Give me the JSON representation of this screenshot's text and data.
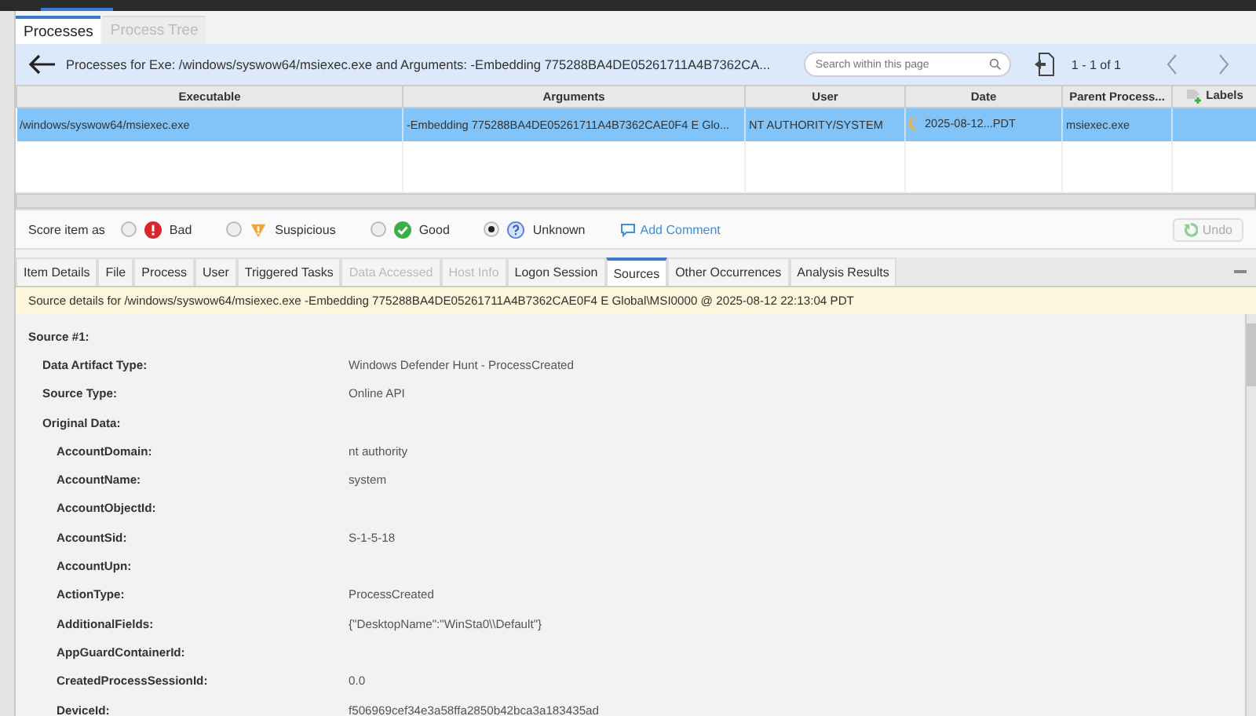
{
  "tabs": [
    {
      "label": "Processes",
      "selected": true
    },
    {
      "label": "Process Tree",
      "selected": false
    }
  ],
  "header": {
    "title": "Processes for Exe: /windows/syswow64/msiexec.exe and Arguments: -Embedding 775288BA4DE05261711A4B7362CA...",
    "search": {
      "placeholder": "Search within this page"
    },
    "range": "1 - 1 of 1"
  },
  "table": {
    "columns": [
      "Executable",
      "Arguments",
      "User",
      "Date",
      "Parent Process...",
      "Labels"
    ],
    "rows": [
      {
        "selected": true,
        "cells": [
          "/windows/syswow64/msiexec.exe",
          "-Embedding 775288BA4DE05261711A4B7362CAE0F4 E Glo...",
          "NT AUTHORITY/SYSTEM",
          "2025-08-12...PDT",
          "msiexec.exe",
          ""
        ]
      }
    ]
  },
  "score": {
    "label": "Score item as",
    "options": [
      {
        "kind": "bad",
        "label": "Bad",
        "selected": false
      },
      {
        "kind": "suspicious",
        "label": "Suspicious",
        "selected": false
      },
      {
        "kind": "good",
        "label": "Good",
        "selected": false
      },
      {
        "kind": "unknown",
        "label": "Unknown",
        "selected": true
      }
    ],
    "comment": "Add Comment",
    "undo": {
      "label": "Undo",
      "disabled": true
    }
  },
  "detail_tabs": [
    {
      "label": "Item Details",
      "selected": false,
      "disabled": false
    },
    {
      "label": "File",
      "selected": false,
      "disabled": false
    },
    {
      "label": "Process",
      "selected": false,
      "disabled": false
    },
    {
      "label": "User",
      "selected": false,
      "disabled": false
    },
    {
      "label": "Triggered Tasks",
      "selected": false,
      "disabled": false
    },
    {
      "label": "Data Accessed",
      "selected": false,
      "disabled": true
    },
    {
      "label": "Host Info",
      "selected": false,
      "disabled": true
    },
    {
      "label": "Logon Session",
      "selected": false,
      "disabled": false
    },
    {
      "label": "Sources",
      "selected": true,
      "disabled": false
    },
    {
      "label": "Other Occurrences",
      "selected": false,
      "disabled": false
    },
    {
      "label": "Analysis Results",
      "selected": false,
      "disabled": false
    }
  ],
  "banner": "Source details for /windows/syswow64/msiexec.exe -Embedding 775288BA4DE05261711A4B7362CAE0F4 E Global\\MSI0000 @ 2025-08-12 22:13:04 PDT",
  "details": [
    {
      "label": "Source #1:",
      "children": [
        {
          "label": "Data Artifact Type:",
          "value": "Windows Defender Hunt - ProcessCreated"
        },
        {
          "label": "Source Type:",
          "value": "Online API"
        },
        {
          "label": "Original Data:",
          "children": [
            {
              "label": "AccountDomain:",
              "value": "nt authority"
            },
            {
              "label": "AccountName:",
              "value": "system"
            },
            {
              "label": "AccountObjectId:"
            },
            {
              "label": "AccountSid:",
              "value": "S-1-5-18"
            },
            {
              "label": "AccountUpn:"
            },
            {
              "label": "ActionType:",
              "value": "ProcessCreated"
            },
            {
              "label": "AdditionalFields:",
              "value": "{\"DesktopName\":\"WinSta0\\\\Default\"}"
            },
            {
              "label": "AppGuardContainerId:"
            },
            {
              "label": "CreatedProcessSessionId:",
              "value": "0.0"
            },
            {
              "label": "DeviceId:",
              "value": "f506969cef34e3a58ffa2850b42bca3a183435ad"
            }
          ]
        }
      ]
    }
  ]
}
